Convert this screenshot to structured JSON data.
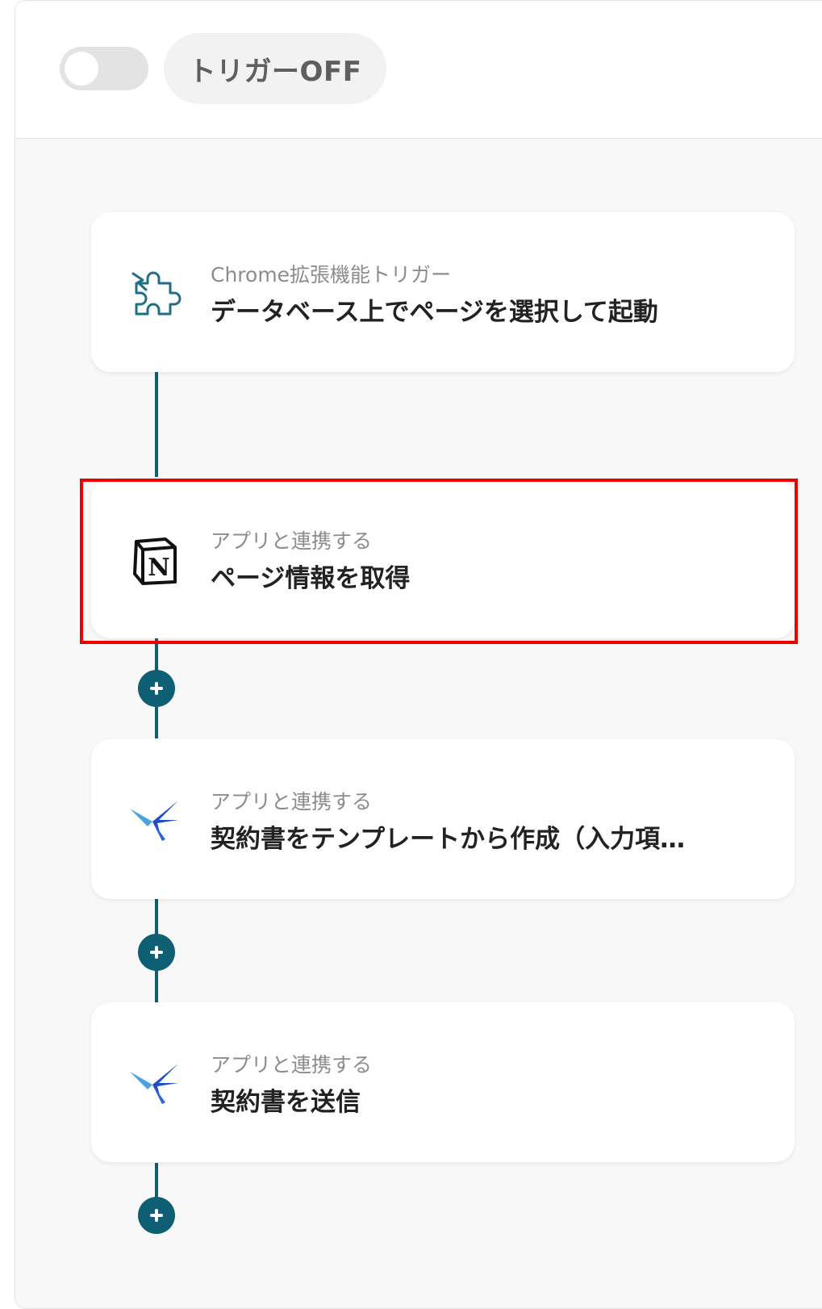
{
  "header": {
    "trigger_status": "トリガーOFF",
    "toggle_on": false
  },
  "steps": [
    {
      "icon": "chrome-extension-puzzle-icon",
      "subtitle": "Chrome拡張機能トリガー",
      "title": "データベース上でページを選択して起動"
    },
    {
      "icon": "notion-icon",
      "subtitle": "アプリと連携する",
      "title": "ページ情報を取得",
      "highlighted": true
    },
    {
      "icon": "cloudsign-bird-icon",
      "subtitle": "アプリと連携する",
      "title": "契約書をテンプレートから作成（入力項…"
    },
    {
      "icon": "cloudsign-bird-icon",
      "subtitle": "アプリと連携する",
      "title": "契約書を送信"
    }
  ],
  "colors": {
    "connector": "#0e5f73",
    "highlight": "#ee0000",
    "toggle_off": "#e3e3e3"
  }
}
